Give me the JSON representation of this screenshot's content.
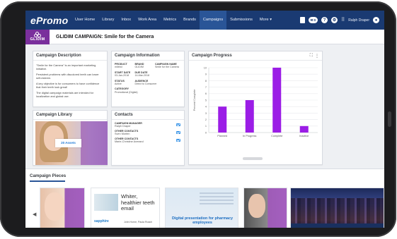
{
  "nav": {
    "brand": "ePromo",
    "items": [
      {
        "label": "User Home",
        "active": false
      },
      {
        "label": "Library",
        "active": false
      },
      {
        "label": "Inbox",
        "active": false
      },
      {
        "label": "Work Area",
        "active": false
      },
      {
        "label": "Metrics",
        "active": false
      },
      {
        "label": "Brands",
        "active": false
      },
      {
        "label": "Campaigns",
        "active": true
      },
      {
        "label": "Submissions",
        "active": false
      },
      {
        "label": "More ▾",
        "active": false
      }
    ],
    "badge_count": "0",
    "user_name": "Ralph Draper"
  },
  "campaign": {
    "logo_text": "GLIDIM",
    "title": "GLIDIM CAMPAIGN: Smile for the Camera"
  },
  "description": {
    "title": "Campaign Description",
    "paragraphs": [
      "\"Smile for the Camera\" is an important marketing initiative.",
      "Persistent problems with discolored teeth can lower self-esteem.",
      "A key objective is for consumers to have confidence that their teeth look great!",
      "The digital campaign materials are intended for localization and global use."
    ]
  },
  "info": {
    "title": "Campaign Information",
    "product_label": "PRODUCT",
    "product_value": "milebd",
    "brand_label": "BRAND",
    "brand_value": "GLIDIM",
    "name_label": "CAMPAIGN NAME",
    "name_value": "Smile for the Camera",
    "start_label": "START DATE",
    "start_value": "03-Jan-2018",
    "due_label": "DUE DATE",
    "due_value": "14-Mar-2018",
    "status_label": "STATUS",
    "status_value": "Active",
    "audience_label": "AUDIENCE",
    "audience_value": "Direct to Consumer",
    "category_label": "CATEGORY",
    "category_value": "Promotional (Digital)"
  },
  "progress": {
    "title": "Campaign Progress",
    "toolbar_expand": "⛶",
    "toolbar_menu": "⋮"
  },
  "chart_data": {
    "type": "bar",
    "title": "",
    "categories": [
      "Planned",
      "In Progress",
      "Complete",
      "Inactive"
    ],
    "values": [
      4,
      5,
      10,
      1
    ],
    "ylabel": "Percent Complete",
    "xlabel": "",
    "ylim": [
      0,
      10
    ],
    "yticks": [
      0,
      1,
      2,
      3,
      4,
      5,
      6,
      7,
      8,
      9,
      10
    ],
    "bar_color": "#9b1de6",
    "grid": true
  },
  "library": {
    "title": "Campaign Library",
    "assets_label": "20 Assets"
  },
  "contacts": {
    "title": "Contacts",
    "entries": [
      {
        "label": "CAMPAIGN MANAGER",
        "name": "Ralph Draper"
      },
      {
        "label": "OTHER CONTACTS",
        "name": "Sven Morten"
      },
      {
        "label": "OTHER CONTACTS",
        "name": "Marie-Christine Averand"
      }
    ]
  },
  "pieces": {
    "title": "Campaign Pieces",
    "thumb2_headline": "Whiter, healthier teeth email",
    "thumb2_logo": "sapphire",
    "thumb2_names": "John Horne, Paula Roach",
    "thumb3_headline": "Digital presentation for pharmacy employees"
  }
}
